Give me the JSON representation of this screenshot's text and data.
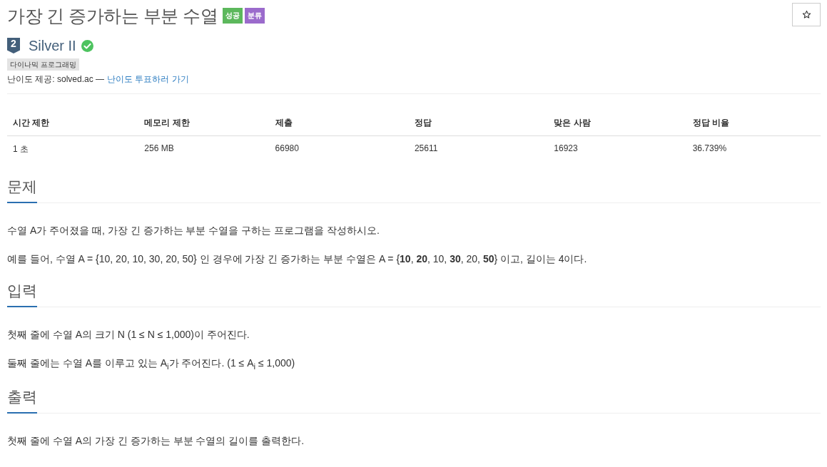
{
  "problem": {
    "title": "가장 긴 증가하는 부분 수열",
    "badges": [
      {
        "label": "성공",
        "color": "#5cb85c"
      },
      {
        "label": "분류",
        "color": "#9b6bcc"
      }
    ]
  },
  "tier": {
    "rank": "2",
    "label": "Silver II",
    "solved": true
  },
  "tags": [
    "다이나믹 프로그래밍"
  ],
  "difficulty": {
    "text": "난이도 제공: solved.ac —",
    "link": "난이도 투표하러 가기"
  },
  "stats": {
    "columns": [
      "시간 제한",
      "메모리 제한",
      "제출",
      "정답",
      "맞은 사람",
      "정답 비율"
    ],
    "rows": [
      [
        "1 초",
        "256 MB",
        "66980",
        "25611",
        "16923",
        "36.739%"
      ]
    ]
  },
  "sections": [
    {
      "heading": "문제",
      "paragraphs": [
        "수열 A가 주어졌을 때, 가장 긴 증가하는 부분 수열을 구하는 프로그램을 작성하시오.",
        "예를 들어, 수열 A = {10, 20, 10, 30, 20, 50} 인 경우에 가장 긴 증가하는 부분 수열은 A = {**10**, **20**, 10, **30**, 20, **50**} 이고, 길이는 4이다."
      ]
    },
    {
      "heading": "입력",
      "paragraphs": [
        "첫째 줄에 수열 A의 크기 N (1 ≤ N ≤ 1,000)이 주어진다.",
        "둘째 줄에는 수열 A를 이루고 있는 A$_{i}$가 주어진다. (1 ≤ A$_{i}$ ≤ 1,000)"
      ]
    },
    {
      "heading": "출력",
      "paragraphs": [
        "첫째 줄에 수열 A의 가장 긴 증가하는 부분 수열의 길이를 출력한다."
      ]
    }
  ]
}
